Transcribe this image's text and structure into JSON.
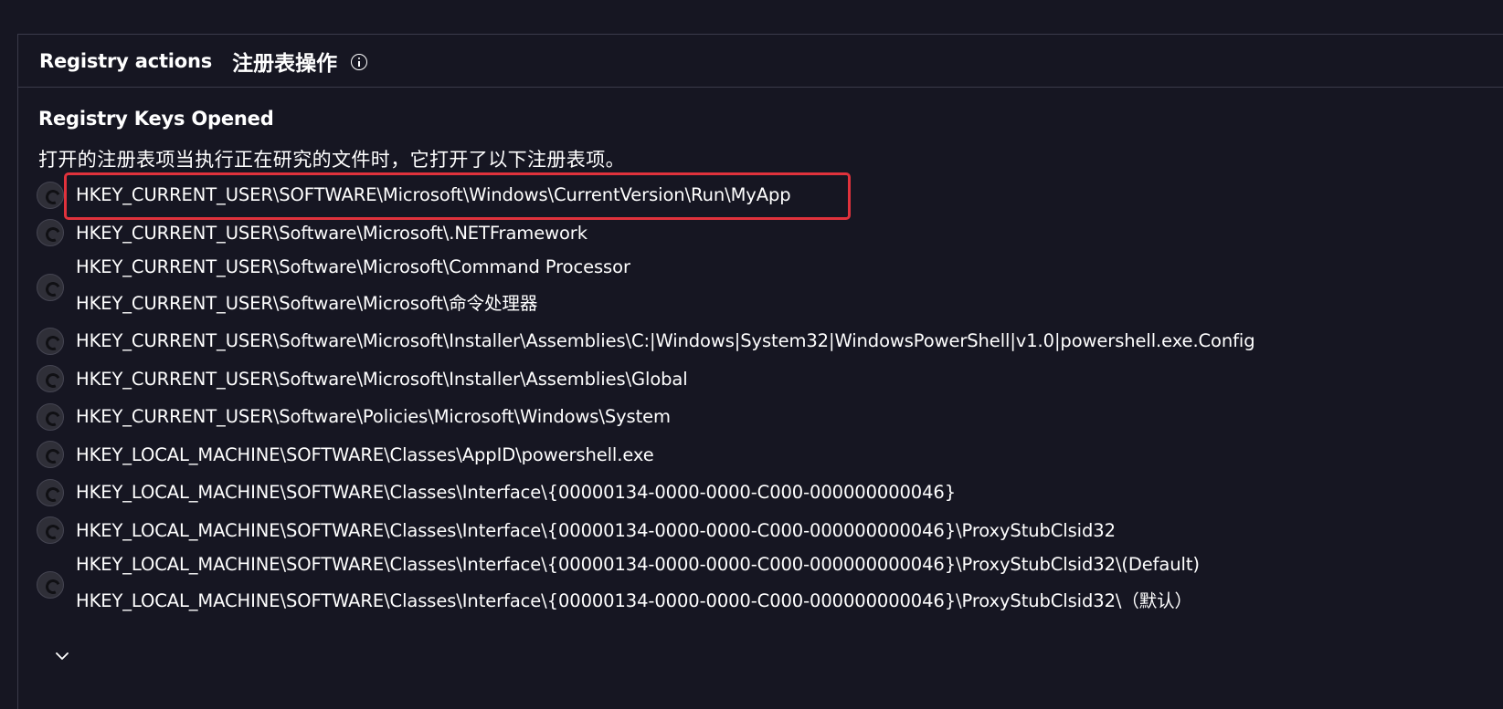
{
  "section": {
    "title_en": "Registry actions",
    "title_zh": "注册表操作",
    "info_icon": "info-icon"
  },
  "subsection": {
    "title": "Registry Keys Opened",
    "description": "打开的注册表项当执行正在研究的文件时，它打开了以下注册表项。"
  },
  "keys": [
    {
      "lines": [
        "HKEY_CURRENT_USER\\SOFTWARE\\Microsoft\\Windows\\CurrentVersion\\Run\\MyApp"
      ],
      "highlighted": true
    },
    {
      "lines": [
        "HKEY_CURRENT_USER\\Software\\Microsoft\\.NETFramework"
      ]
    },
    {
      "lines": [
        "HKEY_CURRENT_USER\\Software\\Microsoft\\Command Processor",
        "HKEY_CURRENT_USER\\Software\\Microsoft\\命令处理器"
      ]
    },
    {
      "lines": [
        "HKEY_CURRENT_USER\\Software\\Microsoft\\Installer\\Assemblies\\C:|Windows|System32|WindowsPowerShell|v1.0|powershell.exe.Config"
      ]
    },
    {
      "lines": [
        "HKEY_CURRENT_USER\\Software\\Microsoft\\Installer\\Assemblies\\Global"
      ]
    },
    {
      "lines": [
        "HKEY_CURRENT_USER\\Software\\Policies\\Microsoft\\Windows\\System"
      ]
    },
    {
      "lines": [
        "HKEY_LOCAL_MACHINE\\SOFTWARE\\Classes\\AppID\\powershell.exe"
      ]
    },
    {
      "lines": [
        "HKEY_LOCAL_MACHINE\\SOFTWARE\\Classes\\Interface\\{00000134-0000-0000-C000-000000000046}"
      ]
    },
    {
      "lines": [
        "HKEY_LOCAL_MACHINE\\SOFTWARE\\Classes\\Interface\\{00000134-0000-0000-C000-000000000046}\\ProxyStubClsid32"
      ]
    },
    {
      "lines": [
        "HKEY_LOCAL_MACHINE\\SOFTWARE\\Classes\\Interface\\{00000134-0000-0000-C000-000000000046}\\ProxyStubClsid32\\(Default)",
        "HKEY_LOCAL_MACHINE\\SOFTWARE\\Classes\\Interface\\{00000134-0000-0000-C000-000000000046}\\ProxyStubClsid32\\（默认）"
      ]
    }
  ],
  "expand": {
    "icon": "chevron-down-icon"
  },
  "colors": {
    "background": "#161622",
    "text": "#ffffff",
    "highlight": "#e0323c",
    "divider": "#3a3a4a"
  }
}
